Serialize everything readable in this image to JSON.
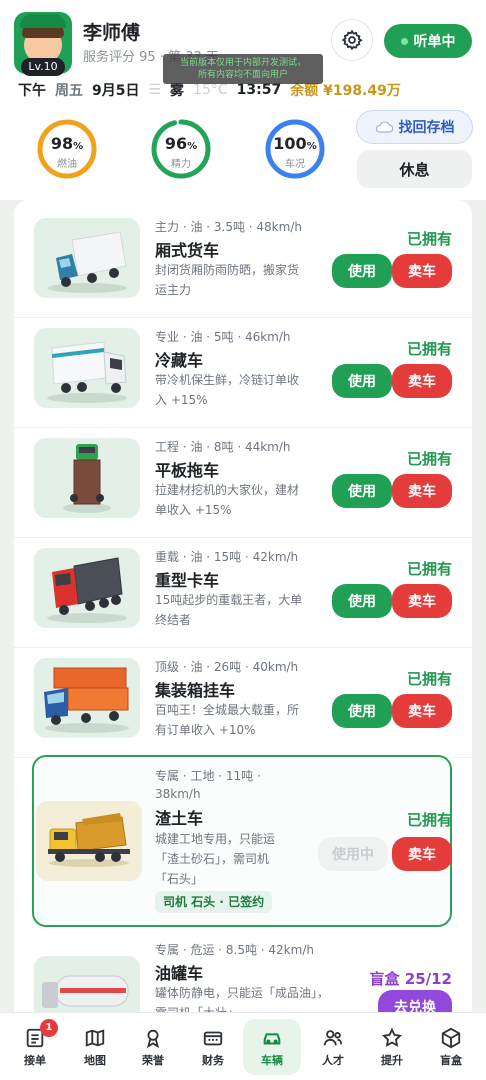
{
  "profile": {
    "name": "李师傅",
    "level": "Lv.10",
    "rating_text": "服务评分 95 · 第 33 天",
    "notice_line1": "当前版本仅用于内部开发测试，",
    "notice_line2": "所有内容均不面向用户"
  },
  "header_buttons": {
    "listen_label": "听单中",
    "recover_label": "找回存档",
    "rest_label": "休息"
  },
  "status": {
    "time_of_day": "下午",
    "weekday": "周五",
    "date": "9月5日",
    "weather_icon": "☰",
    "weather": "雾",
    "temperature": "15°C",
    "clock": "13:57",
    "balance": "余额 ¥198.49万"
  },
  "gauges": [
    {
      "label": "燃油",
      "value": "98",
      "unit": "%",
      "percent": 98,
      "color": "#f0a21b"
    },
    {
      "label": "精力",
      "value": "96",
      "unit": "%",
      "percent": 96,
      "color": "#22a559"
    },
    {
      "label": "车况",
      "value": "100",
      "unit": "%",
      "percent": 100,
      "color": "#3b82f0"
    }
  ],
  "trucks": [
    {
      "meta": "主力 · 油 · 3.5吨 · 48km/h",
      "name": "厢式货车",
      "desc1": "封闭货厢防雨防晒，搬家货",
      "desc2": "运主力",
      "status": "已拥有",
      "use": "使用",
      "sell": "卖车"
    },
    {
      "meta": "专业 · 油 · 5吨 · 46km/h",
      "name": "冷藏车",
      "desc1": "带冷机保生鲜，冷链订单收",
      "desc2": "入 +15%",
      "status": "已拥有",
      "use": "使用",
      "sell": "卖车"
    },
    {
      "meta": "工程 · 油 · 8吨 · 44km/h",
      "name": "平板拖车",
      "desc1": "拉建材挖机的大家伙，建材",
      "desc2": "单收入 +15%",
      "status": "已拥有",
      "use": "使用",
      "sell": "卖车"
    },
    {
      "meta": "重载 · 油 · 15吨 · 42km/h",
      "name": "重型卡车",
      "desc1": "15吨起步的重载王者，大单",
      "desc2": "终结者",
      "status": "已拥有",
      "use": "使用",
      "sell": "卖车"
    },
    {
      "meta": "顶级 · 油 · 26吨 · 40km/h",
      "name": "集装箱挂车",
      "desc1": "百吨王！全城最大载重，所",
      "desc2": "有订单收入 +10%",
      "status": "已拥有",
      "use": "使用",
      "sell": "卖车"
    }
  ],
  "special_truck": {
    "meta1": "专属 · 工地 · 11吨 ·",
    "meta2": "38km/h",
    "name": "渣土车",
    "desc1": "城建工地专用，只能运",
    "desc2": "「渣土砂石」，需司机",
    "desc3": "「石头」",
    "tag": "司机 石头 · 已签约",
    "status": "已拥有",
    "use": "使用中",
    "sell": "卖车"
  },
  "tanker_truck": {
    "meta": "专属 · 危运 · 8.5吨 · 42km/h",
    "name": "油罐车",
    "desc1": "罐体防静电，只能运「成品油」，",
    "desc2": "需司机「大壮」",
    "box_count": "盲盒 25/12",
    "redeem": "去兑换"
  },
  "nav": [
    {
      "label": "接单",
      "icon": "order-icon",
      "badge": "1"
    },
    {
      "label": "地图",
      "icon": "map-icon"
    },
    {
      "label": "荣誉",
      "icon": "medal-icon"
    },
    {
      "label": "财务",
      "icon": "wallet-icon"
    },
    {
      "label": "车辆",
      "icon": "car-icon",
      "active": true
    },
    {
      "label": "人才",
      "icon": "people-icon"
    },
    {
      "label": "提升",
      "icon": "star-icon"
    },
    {
      "label": "盲盒",
      "icon": "box-icon"
    }
  ]
}
